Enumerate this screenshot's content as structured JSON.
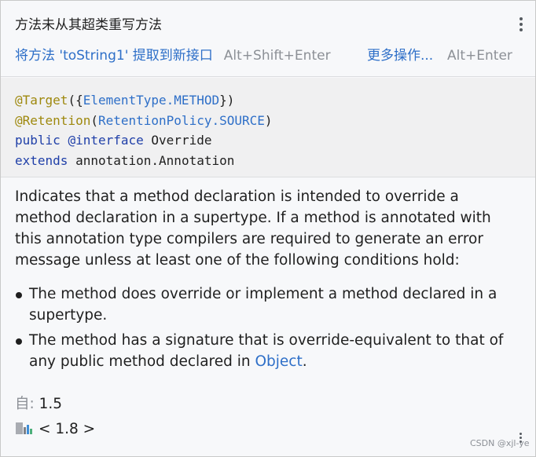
{
  "header": {
    "problem_title": "方法未从其超类重写方法",
    "fix_action": "将方法 'toString1' 提取到新接口",
    "fix_shortcut": "Alt+Shift+Enter",
    "more_actions": "更多操作...",
    "more_shortcut": "Alt+Enter"
  },
  "code": {
    "line1": {
      "at_target": "@Target",
      "open": "({",
      "element_type": "ElementType.METHOD",
      "close": "})"
    },
    "line2": {
      "at_retention": "@Retention",
      "open": "(",
      "retention_policy": "RetentionPolicy.SOURCE",
      "close": ")"
    },
    "line3": {
      "kw_public": "public",
      "kw_interface": "@interface",
      "name": "Override"
    },
    "line4": {
      "kw_extends": "extends",
      "parent": "annotation.Annotation"
    }
  },
  "doc": {
    "description": "Indicates that a method declaration is intended to override a method declaration in a supertype. If a method is annotated with this annotation type compilers are required to generate an error message unless at least one of the following conditions hold:",
    "bullet1": "The method does override or implement a method declared in a supertype.",
    "bullet2_text": "The method has a signature that is override-equivalent to that of any public method declared in ",
    "bullet2_link": "Object",
    "bullet2_end": ".",
    "since_label": "自:",
    "since_value": "1.5",
    "sdk_label": "< 1.8 >"
  },
  "watermark": "CSDN @xjl-ye",
  "icons": {
    "menu": "vertical-ellipsis-icon",
    "library": "library-icon"
  },
  "colors": {
    "link": "#2e6fc8",
    "annotation": "#9e880d",
    "keyword": "#1f3fa8",
    "muted": "#8c9096",
    "panel_bg": "#f7f8fa",
    "code_bg": "#f0f0f1"
  }
}
